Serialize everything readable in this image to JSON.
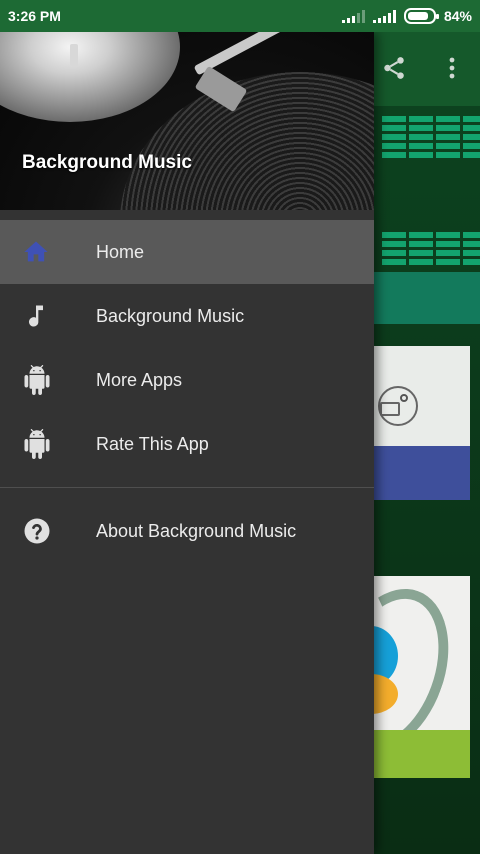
{
  "status_bar": {
    "time": "3:26 PM",
    "battery": "84%",
    "battery_level": 0.84
  },
  "drawer": {
    "header_title": "Background Music",
    "items": [
      {
        "label": "Home",
        "icon": "home-icon",
        "active": true
      },
      {
        "label": "Background Music",
        "icon": "music-note-icon",
        "active": false
      },
      {
        "label": "More Apps",
        "icon": "android-icon",
        "active": false
      },
      {
        "label": "Rate This App",
        "icon": "android-icon",
        "active": false
      }
    ],
    "secondary_items": [
      {
        "label": "About Background Music",
        "icon": "help-icon"
      }
    ]
  },
  "colors": {
    "status_bar": "#1d6a34",
    "toolbar": "#15592b",
    "drawer_bg": "#333333",
    "active_item": "#595959",
    "home_icon": "#3f51b5",
    "icon_default": "#e0e0e0"
  }
}
